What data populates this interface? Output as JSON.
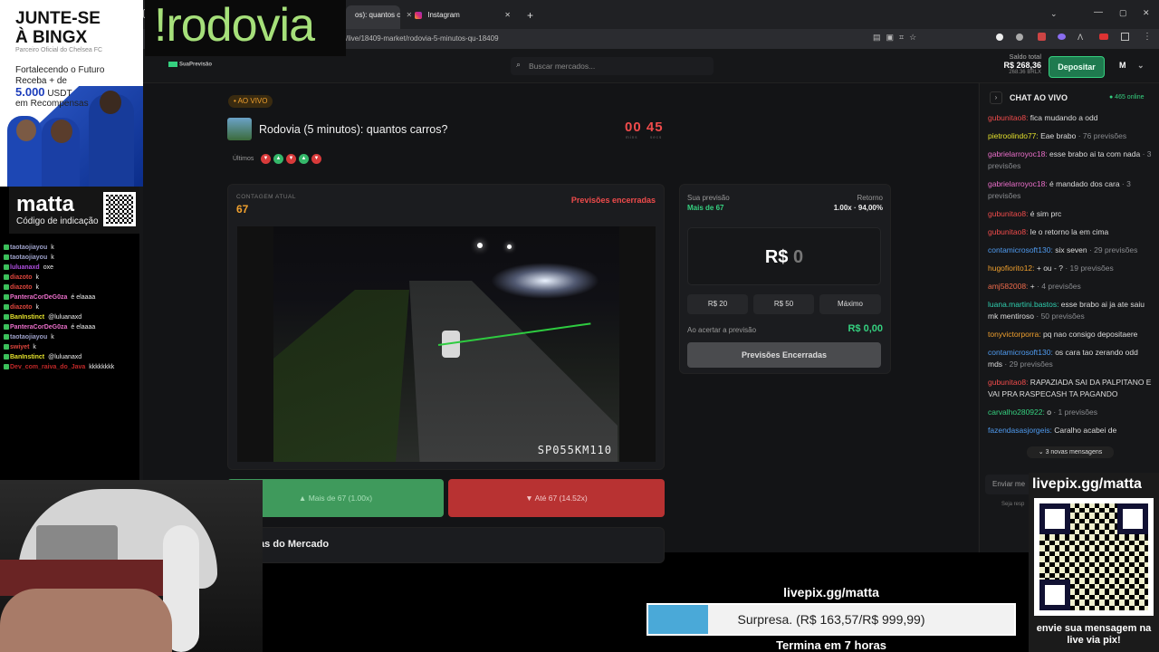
{
  "overlay": {
    "ad_line1": "JUNTE-SE",
    "ad_line2": "À BINGX",
    "ad_partner": "Parceiro Oficial do Chelsea FC",
    "ad_copy1": "Fortalecendo o Futuro",
    "ad_copy2": "Receba + de",
    "ad_amount": "5.000",
    "ad_currency": " USDT",
    "ad_copy3": "em Recompensas",
    "matta_logo": "matta",
    "matta_sub": "Código de indicação",
    "rodovia_text": "!rodovia"
  },
  "stream_chat": [
    {
      "user": "taotaojiayou",
      "msg": "k",
      "color": "#9da1c9"
    },
    {
      "user": "taotaojiayou",
      "msg": "k",
      "color": "#9da1c9"
    },
    {
      "user": "luluanaxd",
      "msg": "oxe",
      "color": "#b04fe0"
    },
    {
      "user": "diazoto",
      "msg": "k",
      "color": "#e0463d"
    },
    {
      "user": "diazoto",
      "msg": "k",
      "color": "#e0463d"
    },
    {
      "user": "PanteraCorDeG0za",
      "msg": "é elaaaa",
      "color": "#ea6ec9"
    },
    {
      "user": "diazoto",
      "msg": "k",
      "color": "#e0463d"
    },
    {
      "user": "BanInstinct",
      "msg": "@luluanaxd",
      "color": "#e3e02c"
    },
    {
      "user": "PanteraCorDeG0za",
      "msg": "é elaaaa",
      "color": "#ea6ec9"
    },
    {
      "user": "taotaojiayou",
      "msg": "k",
      "color": "#9da1c9"
    },
    {
      "user": "swiyet",
      "msg": "k",
      "color": "#e0463d"
    },
    {
      "user": "BanInstinct",
      "msg": "@luluanaxd",
      "color": "#e3e02c"
    },
    {
      "user": "Dev_com_raiva_do_Java",
      "msg": "kkkkkkkk",
      "color": "#c02828"
    }
  ],
  "browser": {
    "tab1_label": "os): quantos c",
    "tab2_label": "Instagram",
    "new_tab": "+",
    "url": "/live/18409-market/rodovia-5-minutos-qu-18409"
  },
  "header": {
    "logo": "SuaPrevisão",
    "search_placeholder": "Buscar mercados...",
    "balance_label": "Saldo total",
    "balance_value": "R$ 268,36",
    "balance_brlx": "268.36 BRLX",
    "deposit_label": "Depositar",
    "avatar": "M"
  },
  "market": {
    "live_badge": "• AO VIVO",
    "title": "Rodovia (5 minutos): quantos carros?",
    "timer_min": "00",
    "timer_sec": "45",
    "timer_min_label": "mins",
    "timer_sec_label": "secs",
    "recent_label": "Últimos",
    "recent_results": [
      "down",
      "up",
      "down",
      "up",
      "down"
    ],
    "count_label": "CONTAGEM ATUAL",
    "count_value": "67",
    "status": "Previsões encerradas",
    "camera_id": "SP055KM110",
    "btn_up": "Mais de 67 (1.00x)",
    "btn_down": "Até 67 (14.52x)",
    "rules_title": "Regras do Mercado"
  },
  "prediction": {
    "your_label": "Sua previsão",
    "your_value": "Mais de 67",
    "return_label": "Retorno",
    "return_value": "1.00x · 94,00%",
    "currency": "R$",
    "amount": "0",
    "quick": [
      "R$ 20",
      "R$ 50",
      "Máximo"
    ],
    "payout_label": "Ao acertar a previsão",
    "payout_value": "R$ 0,00",
    "closed_button": "Previsões Encerradas"
  },
  "chat": {
    "title": "CHAT AO VIVO",
    "online": "● 465 online",
    "new_messages": "⌄ 3 novas mensagens",
    "input_placeholder": "Enviar me",
    "footer_hint": "Seja resp",
    "messages": [
      {
        "user": "gubunitao8:",
        "text": " fica mudando a odd",
        "color": "#ef4b4b"
      },
      {
        "user": "pietroolindo77:",
        "text": " Eae brabo",
        "extra": " · 76 previsões",
        "color": "#e3e02c"
      },
      {
        "user": "gabrielarroyoc18:",
        "text": " esse brabo ai ta com nada",
        "extra": " · 3 previsões",
        "color": "#ea6ec9"
      },
      {
        "user": "gabrielarroyoc18:",
        "text": " é mandado dos cara",
        "extra": " · 3 previsões",
        "color": "#ea6ec9"
      },
      {
        "user": "gubunitao8:",
        "text": " é sim prc",
        "color": "#ef4b4b"
      },
      {
        "user": "gubunitao8:",
        "text": " le o retorno la em cima",
        "color": "#ef4b4b"
      },
      {
        "user": "contamicrosoft130:",
        "text": " six seven",
        "extra": " · 29 previsões",
        "color": "#4f9bf0"
      },
      {
        "user": "hugofiorito12:",
        "text": " + ou - ?",
        "extra": " · 19 previsões",
        "color": "#f0a02e"
      },
      {
        "user": "amj582008:",
        "text": " + ",
        "extra": "· 4 previsões",
        "color": "#ef6b4b"
      },
      {
        "user": "luana.martini.bastos:",
        "text": " esse brabo ai ja ate saiu mk mentiroso",
        "extra": " · 50 previsões",
        "color": "#2fd0b0"
      },
      {
        "user": "tonyvictorporra:",
        "text": " pq nao consigo depositaere",
        "color": "#f0a02e"
      },
      {
        "user": "contamicrosoft130:",
        "text": " os cara tao zerando odd mds",
        "extra": " · 29 previsões",
        "color": "#4f9bf0"
      },
      {
        "user": "gubunitao8:",
        "text": " RAPAZIADA SAI DA PALPITANO E VAI PRA RASPECASH TA PAGANDO",
        "color": "#ef4b4b"
      },
      {
        "user": "carvalho280922:",
        "text": " o",
        "extra": " · 1 previsões",
        "color": "#35d07f"
      },
      {
        "user": "fazendasasjorgeis:",
        "text": " Caralho acabei de",
        "color": "#4f9bf0"
      }
    ]
  },
  "livepix": {
    "title": "livepix.gg/matta",
    "caption": "envie sua mensagem na live via pix!",
    "goal_title": "livepix.gg/matta",
    "goal_text": "Surpresa. (R$ 163,57/R$ 999,99)",
    "goal_progress": 0.1636,
    "goal_time": "Termina em 7 horas"
  }
}
